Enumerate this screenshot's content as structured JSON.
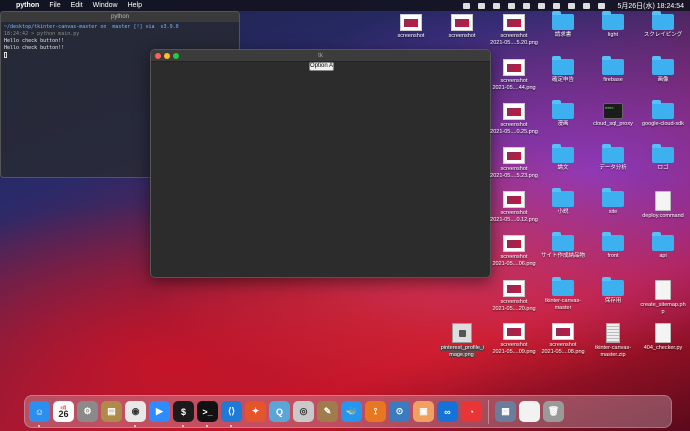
{
  "menubar": {
    "app": "python",
    "menus": [
      "File",
      "Edit",
      "Window",
      "Help"
    ],
    "clock": "5月26日(水) 18:24:54"
  },
  "terminal": {
    "title": "python",
    "line1": "~/desktop/tkinter-canvas-master on  master [!] via  v3.9.0",
    "line2": "18:24:42 > python main.py",
    "line3": "Hello check button!!",
    "line4": "Hello check button!!"
  },
  "tk": {
    "title": "tk",
    "option_label": "Option A"
  },
  "desktop": {
    "icons": [
      {
        "label": "screenshot",
        "kind": "shot"
      },
      {
        "label": "screenshot",
        "kind": "shot"
      },
      {
        "label": "screenshot\n2021-05....5.20.png",
        "kind": "shot"
      },
      {
        "label": "請求書",
        "kind": "folder"
      },
      {
        "label": "light",
        "kind": "folder"
      },
      {
        "label": "スクレイピング",
        "kind": "folder"
      },
      {
        "label": "screenshot\n2021-05....44.png",
        "kind": "shot"
      },
      {
        "label": "確定申告",
        "kind": "folder"
      },
      {
        "label": "firebase",
        "kind": "folder"
      },
      {
        "label": "画像",
        "kind": "folder"
      },
      {
        "label": "screenshot\n2021-05....0.25.png",
        "kind": "shot"
      },
      {
        "label": "漫画",
        "kind": "folder"
      },
      {
        "label": "cloud_sql_proxy",
        "kind": "term"
      },
      {
        "label": "google-cloud-sdk",
        "kind": "folder"
      },
      {
        "label": "screenshot\n2021-05....5.23.png",
        "kind": "shot"
      },
      {
        "label": "論文",
        "kind": "folder"
      },
      {
        "label": "データ分析",
        "kind": "folder"
      },
      {
        "label": "ロゴ",
        "kind": "folder"
      },
      {
        "label": "screenshot\n2021-05....0.12.png",
        "kind": "shot"
      },
      {
        "label": "小説",
        "kind": "folder"
      },
      {
        "label": "site",
        "kind": "folder"
      },
      {
        "label": "deploy.command",
        "kind": "doc"
      },
      {
        "label": "screenshot\n2021-05....06.png",
        "kind": "shot"
      },
      {
        "label": "サイト作成納品物",
        "kind": "folder"
      },
      {
        "label": "front",
        "kind": "folder"
      },
      {
        "label": "api",
        "kind": "folder"
      },
      {
        "label": "screenshot\n2021-05....20.png",
        "kind": "shot"
      },
      {
        "label": "tkinter-canvas-\nmaster",
        "kind": "folder"
      },
      {
        "label": "保存用",
        "kind": "folder"
      },
      {
        "label": "create_sitemap.ph\np",
        "kind": "doc"
      },
      {
        "label": "pinterest_profile_i\nmage.png",
        "kind": "pin"
      },
      {
        "label": "screenshot\n2021-05....09.png",
        "kind": "shot"
      },
      {
        "label": "screenshot\n2021-05....08.png",
        "kind": "shot"
      },
      {
        "label": "tkinter-canvas-\nmaster.zip",
        "kind": "zip"
      },
      {
        "label": "404_checker.py",
        "kind": "doc"
      }
    ]
  },
  "dock": {
    "calendar_month": "5月",
    "calendar_day": "26",
    "apps": [
      {
        "name": "finder-icon",
        "color": "#2b8ff0",
        "glyph": "☺"
      },
      {
        "name": "calendar-icon",
        "color": "#ffffff",
        "glyph": ""
      },
      {
        "name": "system-preferences-icon",
        "color": "#8a8a8a",
        "glyph": "⚙"
      },
      {
        "name": "archive-icon",
        "color": "#b08a4a",
        "glyph": "▤"
      },
      {
        "name": "chrome-icon",
        "color": "#e8e8e8",
        "glyph": "◉"
      },
      {
        "name": "zoom-icon",
        "color": "#2d8cff",
        "glyph": "▶"
      },
      {
        "name": "terminal-icon",
        "color": "#1b1b1b",
        "glyph": "$"
      },
      {
        "name": "iterm-icon",
        "color": "#111111",
        "glyph": ">_"
      },
      {
        "name": "vscode-icon",
        "color": "#1f7ad6",
        "glyph": "⟨⟩"
      },
      {
        "name": "safari-icon",
        "color": "#e4552b",
        "glyph": "✦"
      },
      {
        "name": "quicktime-icon",
        "color": "#5aa6d8",
        "glyph": "Q"
      },
      {
        "name": "sequel-icon",
        "color": "#c9c9c9",
        "glyph": "◎"
      },
      {
        "name": "scripts-icon",
        "color": "#a07c4c",
        "glyph": "✎"
      },
      {
        "name": "docker-icon",
        "color": "#2496ed",
        "glyph": "🐳"
      },
      {
        "name": "sourcetree-icon",
        "color": "#e87722",
        "glyph": "⟟"
      },
      {
        "name": "mysql-workbench-icon",
        "color": "#3a7bbf",
        "glyph": "⊙"
      },
      {
        "name": "preview-icon",
        "color": "#f0a060",
        "glyph": "▣"
      },
      {
        "name": "infinity-icon",
        "color": "#1572d6",
        "glyph": "∞"
      },
      {
        "name": "clock-icon",
        "color": "#e93535",
        "glyph": "◔"
      }
    ]
  }
}
